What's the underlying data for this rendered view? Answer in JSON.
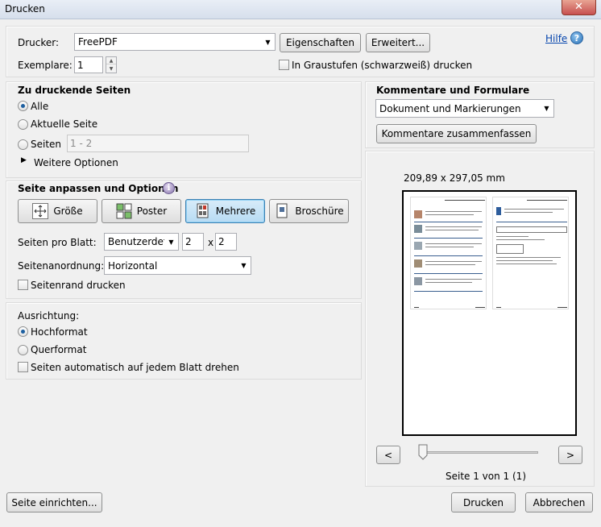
{
  "window": {
    "title": "Drucken",
    "close_symbol": "✕"
  },
  "printer": {
    "label": "Drucker:",
    "value": "FreePDF",
    "properties_button": "Eigenschaften",
    "advanced_button": "Erweitert...",
    "help_link": "Hilfe",
    "copies_label": "Exemplare:",
    "copies_value": "1",
    "grayscale_label": "In Graustufen (schwarzweiß) drucken"
  },
  "pages": {
    "heading": "Zu druckende Seiten",
    "all_label": "Alle",
    "current_label": "Aktuelle Seite",
    "pages_label": "Seiten",
    "pages_range": "1 - 2",
    "more_options": "Weitere Optionen",
    "selected": "Alle"
  },
  "fit": {
    "heading": "Seite anpassen und Optionen",
    "size_button": "Größe",
    "poster_button": "Poster",
    "multiple_button": "Mehrere",
    "booklet_button": "Broschüre",
    "active_button": "Mehrere",
    "pages_per_sheet_label": "Seiten pro Blatt:",
    "pages_per_sheet_value": "Benutzerdefiniert",
    "cols": "2",
    "times": "x",
    "rows": "2",
    "order_label": "Seitenanordnung:",
    "order_value": "Horizontal",
    "border_label": "Seitenrand drucken"
  },
  "orientation": {
    "heading": "Ausrichtung:",
    "portrait_label": "Hochformat",
    "landscape_label": "Querformat",
    "auto_rotate_label": "Seiten automatisch auf jedem Blatt drehen",
    "selected": "Hochformat"
  },
  "comments": {
    "heading": "Kommentare und Formulare",
    "value": "Dokument und Markierungen",
    "summarize_button": "Kommentare zusammenfassen"
  },
  "preview": {
    "dimensions": "209,89 x 297,05 mm",
    "prev_button": "<",
    "next_button": ">",
    "page_info": "Seite 1 von 1 (1)"
  },
  "footer": {
    "setup_button": "Seite einrichten...",
    "print_button": "Drucken",
    "cancel_button": "Abbrechen"
  },
  "colors": {
    "dialog_bg": "#f0f0f0",
    "active_button_bg": "#b7dbf3",
    "link": "#0645ad"
  }
}
